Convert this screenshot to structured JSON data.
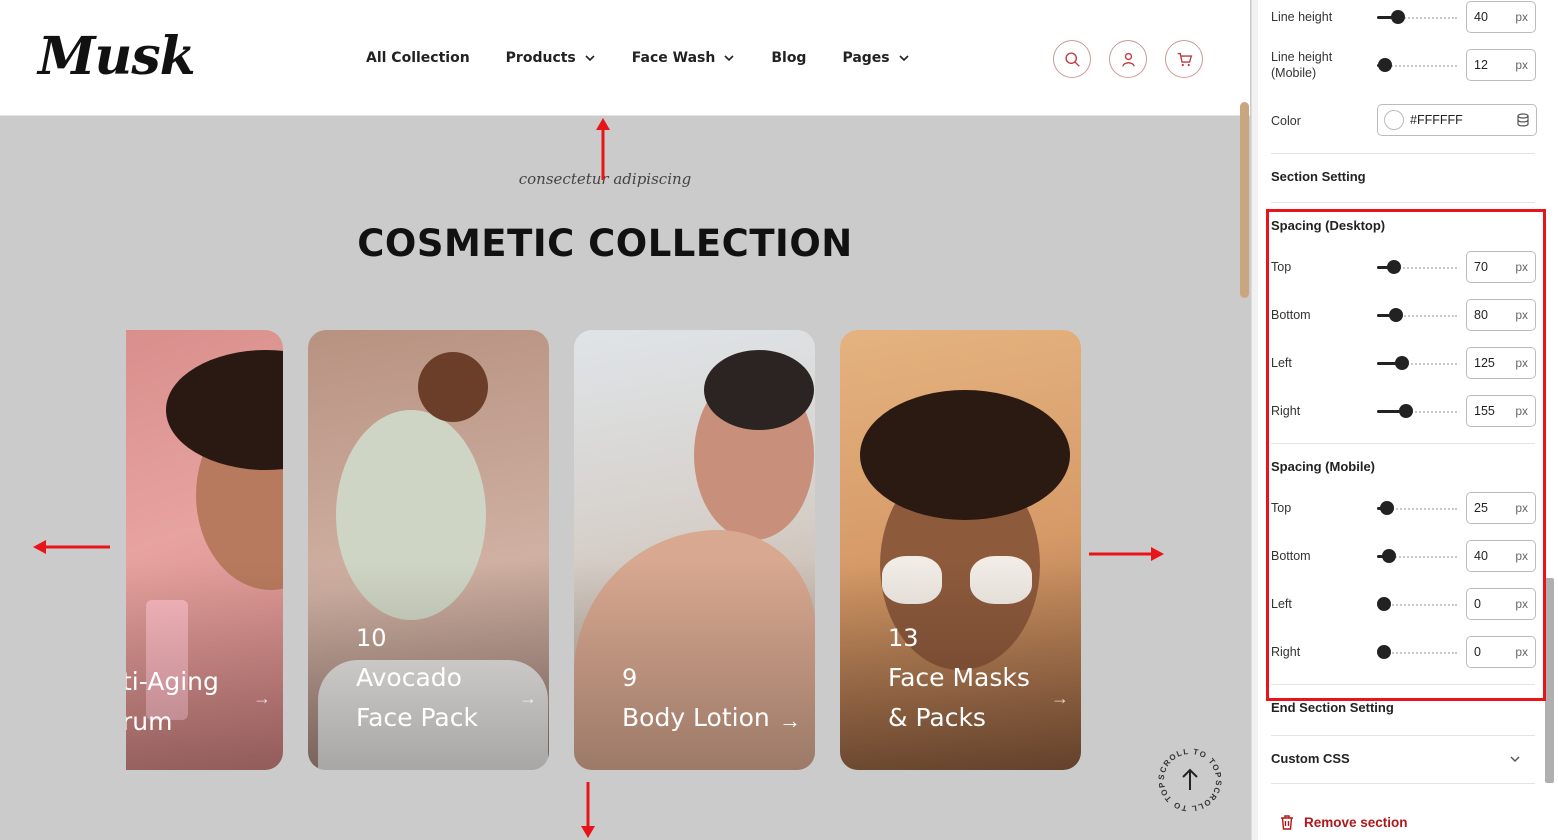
{
  "header": {
    "logo": "Musk",
    "nav": [
      {
        "label": "All Collection",
        "dropdown": false
      },
      {
        "label": "Products",
        "dropdown": true
      },
      {
        "label": "Face Wash",
        "dropdown": true
      },
      {
        "label": "Blog",
        "dropdown": false
      },
      {
        "label": "Pages",
        "dropdown": true
      }
    ],
    "icons": [
      "search-icon",
      "user-icon",
      "cart-icon"
    ],
    "accent_color": "#c0393b"
  },
  "section": {
    "kicker": "consectetur adipiscing",
    "title": "COSMETIC COLLECTION",
    "cards": [
      {
        "count": "",
        "name_line1": "ti-Aging",
        "name_line2": "rum",
        "arrow": "→"
      },
      {
        "count": "10",
        "name_line1": "Avocado",
        "name_line2": "Face Pack",
        "arrow": "→"
      },
      {
        "count": "9",
        "name_line1": "",
        "name_line2": "Body Lotion",
        "arrow": "→"
      },
      {
        "count": "13",
        "name_line1": "Face Masks",
        "name_line2": "& Packs",
        "arrow": "→"
      }
    ],
    "scroll_to_top": "SCROLL TO TOP"
  },
  "sidebar": {
    "typography": {
      "line_height_label": "Line height",
      "line_height_value": "40",
      "line_height_mobile_label": "Line height (Mobile)",
      "line_height_mobile_value": "12",
      "color_label": "Color",
      "color_value": "#FFFFFF",
      "unit": "px"
    },
    "section_setting_label": "Section Setting",
    "spacing_desktop": {
      "label": "Spacing (Desktop)",
      "top_label": "Top",
      "top_value": "70",
      "bottom_label": "Bottom",
      "bottom_value": "80",
      "left_label": "Left",
      "left_value": "125",
      "right_label": "Right",
      "right_value": "155"
    },
    "spacing_mobile": {
      "label": "Spacing (Mobile)",
      "top_label": "Top",
      "top_value": "25",
      "bottom_label": "Bottom",
      "bottom_value": "40",
      "left_label": "Left",
      "left_value": "0",
      "right_label": "Right",
      "right_value": "0"
    },
    "end_section_setting_label": "End Section Setting",
    "custom_css_label": "Custom CSS",
    "remove_section_label": "Remove section",
    "highlight_color": "#e8141a"
  }
}
